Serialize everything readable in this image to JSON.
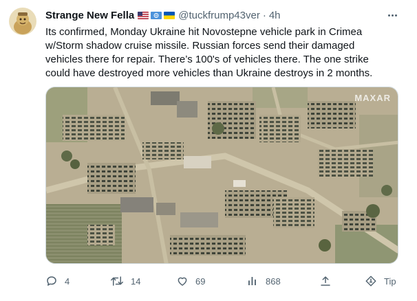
{
  "tweet": {
    "author_name": "Strange New Fella",
    "handle": "@tuckfrump43ver",
    "separator": "·",
    "time": "4h",
    "text_lines": [
      "Its confirmed, Monday Ukraine hit Novostepne vehicle park in Crimea",
      "w/Storm shadow cruise missile. Russian forces send their damaged",
      "vehicles there for repair. There’s 100's of vehicles there. The one strike",
      "could have destroyed more vehicles than Ukraine destroys in 2 months."
    ],
    "flags": [
      "us-flag-icon",
      "un-flag-icon",
      "ukraine-flag-icon"
    ],
    "media": {
      "watermark": "MAXAR",
      "icon": "satellite-image"
    },
    "actions": {
      "reply_count": "4",
      "retweet_count": "14",
      "like_count": "69",
      "view_count": "868",
      "tip_label": "Tip"
    }
  },
  "colors": {
    "text_primary": "#0f1419",
    "text_secondary": "#536471",
    "border": "#cfd9de"
  }
}
